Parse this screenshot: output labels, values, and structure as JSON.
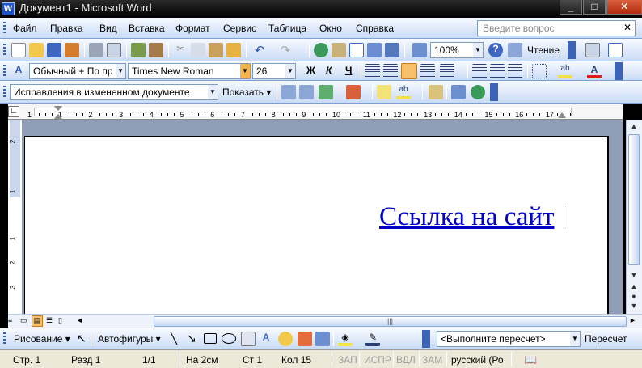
{
  "window": {
    "title": "Документ1 - Microsoft Word",
    "app_icon": "word-icon"
  },
  "menu": {
    "items": [
      "Файл",
      "Правка",
      "Вид",
      "Вставка",
      "Формат",
      "Сервис",
      "Таблица",
      "Окно",
      "Справка"
    ],
    "ask_placeholder": "Введите вопрос"
  },
  "toolbar_standard": {
    "zoom": "100%",
    "read_label": "Чтение"
  },
  "toolbar_format": {
    "style": "Обычный + По пр",
    "font": "Times New Roman",
    "size": "26",
    "bold": "Ж",
    "italic": "К",
    "underline": "Ч"
  },
  "toolbar_review": {
    "display": "Исправления в измененном документе",
    "show_label": "Показать"
  },
  "ruler": {
    "marks": [
      "1",
      "1",
      "2",
      "3",
      "4",
      "5",
      "6",
      "7",
      "8",
      "9",
      "10",
      "11",
      "12",
      "13",
      "14",
      "15",
      "16",
      "17"
    ]
  },
  "vruler": {
    "marks": [
      "2",
      "1",
      "1",
      "2",
      "3"
    ]
  },
  "document": {
    "link_text": "Ссылка на сайт",
    "link_color": "#0000c8"
  },
  "drawing": {
    "draw_label": "Рисование",
    "autoshapes_label": "Автофигуры",
    "recalc_value": "<Выполните пересчет>",
    "recalc_button": "Пересчет"
  },
  "status": {
    "page": "Стр. 1",
    "section": "Разд 1",
    "pages": "1/1",
    "at": "На 2см",
    "line": "Ст 1",
    "col": "Кол 15",
    "rec": "ЗАП",
    "trk": "ИСПР",
    "ext": "ВДЛ",
    "ovr": "ЗАМ",
    "lang": "русский (Ро"
  }
}
